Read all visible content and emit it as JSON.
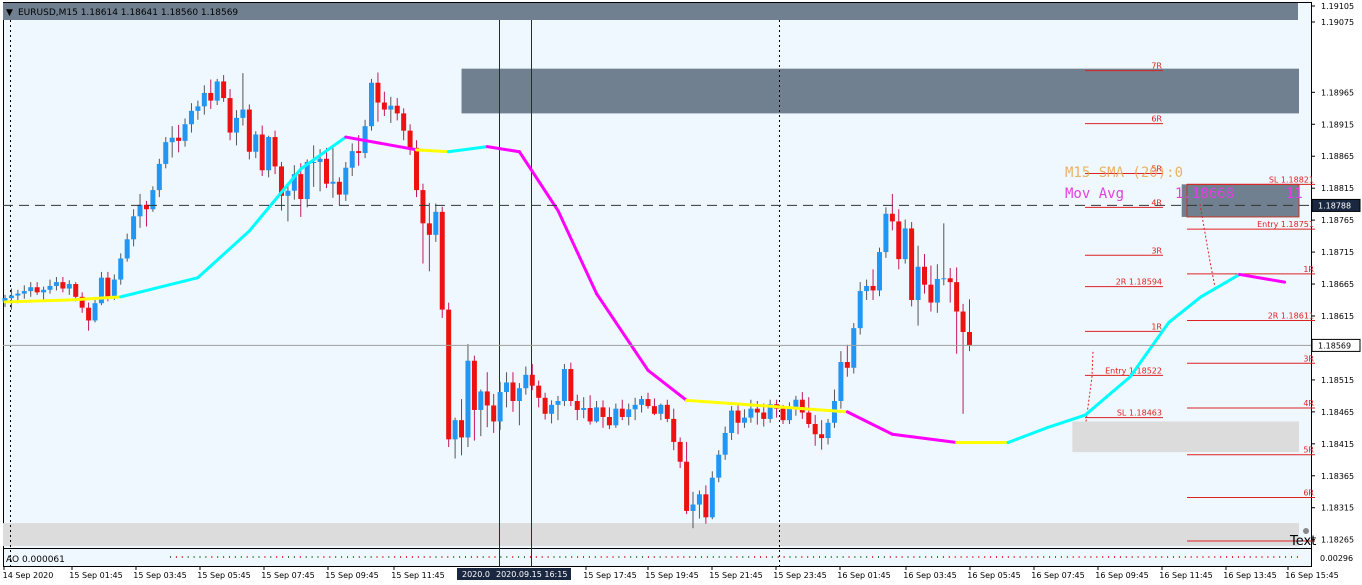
{
  "header": {
    "menu_glyph": "▼",
    "symbol_info": "EURUSD,M15  1.18614 1.18641 1.18560 1.18569"
  },
  "indicator_window": {
    "label": "AO 0.000061",
    "scale_label": "0.00296"
  },
  "chart_data": {
    "type": "candlestick",
    "symbol": "EURUSD",
    "timeframe": "M15",
    "ohlc_header": {
      "open": 1.18614,
      "high": 1.18641,
      "low": 1.1856,
      "close": 1.18569
    },
    "ylim": [
      1.18252,
      1.19075
    ],
    "y_ticks": [
      "1.19105",
      "1.19075",
      "1.18965",
      "1.18915",
      "1.18865",
      "1.18815",
      "1.18765",
      "1.18715",
      "1.18665",
      "1.18615",
      "1.18565",
      "1.18515",
      "1.18465",
      "1.18415",
      "1.18365",
      "1.18315",
      "1.18265"
    ],
    "x_ticks": [
      "14 Sep 2020",
      "15 Sep 01:45",
      "15 Sep 03:45",
      "15 Sep 05:45",
      "15 Sep 07:45",
      "15 Sep 09:45",
      "15 Sep 11:45",
      "15 Sep 17:45",
      "15 Sep 19:45",
      "15 Sep 21:45",
      "15 Sep 23:45",
      "16 Sep 01:45",
      "16 Sep 03:45",
      "16 Sep 05:45",
      "16 Sep 07:45",
      "16 Sep 09:45",
      "16 Sep 11:45",
      "16 Sep 13:45",
      "16 Sep 15:45"
    ],
    "time_markers": [
      "2020.0",
      "2020.09.15 16:15"
    ],
    "price_badges": [
      {
        "price": 1.18788,
        "label": "1.18788",
        "kind": "crosshair"
      },
      {
        "price": 1.18569,
        "label": "1.18569",
        "kind": "bid"
      }
    ],
    "crosshair_price": 1.18788,
    "bid_price": 1.18569,
    "bull_color": "#2196f3",
    "bear_color": "#ee1111",
    "ma_color_up": "#00ffff",
    "ma_color_down": "#ff00ff",
    "ma_color_flat": "#ffff00",
    "sma_label": "M15 SMA (20):0",
    "mov_avg_label": "Mov Avg",
    "mov_avg_value": "1.18668",
    "mov_avg_suffix": "11",
    "text_label": "Text",
    "zones": [
      {
        "name": "supply-zone-top",
        "t0": 71,
        "t1": 210,
        "high": 1.19002,
        "low": 1.18932,
        "color": "#708090"
      },
      {
        "name": "supply-zone-right",
        "t0": 183,
        "t1": 210,
        "high": 1.18821,
        "low": 1.1877,
        "color": "#708090"
      },
      {
        "name": "demand-zone-mid",
        "t0": 166,
        "t1": 210,
        "high": 1.1845,
        "low": 1.18402,
        "color": "#dcdcdc"
      },
      {
        "name": "demand-zone-bottom",
        "t0": 0,
        "t1": 210,
        "high": 1.18291,
        "low": 1.18255,
        "color": "#dcdcdc"
      }
    ],
    "levels_group1": [
      {
        "label": "",
        "price": 1.19089
      },
      {
        "label": "7R",
        "price": 1.18999
      },
      {
        "label": "6R",
        "price": 1.18916
      },
      {
        "label": "5R",
        "price": 1.18838
      },
      {
        "label": "4R",
        "price": 1.18785
      },
      {
        "label": "3R",
        "price": 1.1871
      },
      {
        "label": "2R 1.18594",
        "price": 1.18661
      },
      {
        "label": "1R",
        "price": 1.18591
      },
      {
        "label": "Entry 1.18522",
        "price": 1.18522
      },
      {
        "label": "SL 1.18463",
        "price": 1.18456
      }
    ],
    "levels_group2": [
      {
        "label": "SL 1.18821",
        "price": 1.18821
      },
      {
        "label": "Entry 1.18751",
        "price": 1.18751
      },
      {
        "label": "1R",
        "price": 1.18681
      },
      {
        "label": "2R 1.18611",
        "price": 1.18608
      },
      {
        "label": "3R",
        "price": 1.18541
      },
      {
        "label": "4R",
        "price": 1.18471
      },
      {
        "label": "5R",
        "price": 1.18398
      },
      {
        "label": "6R",
        "price": 1.18331
      },
      {
        "label": "",
        "price": 1.18263
      }
    ],
    "moving_average": [
      [
        0,
        1.18637
      ],
      [
        10,
        1.1864
      ],
      [
        18,
        1.18645
      ],
      [
        30,
        1.18675
      ],
      [
        38,
        1.18748
      ],
      [
        46,
        1.18845
      ],
      [
        53,
        1.18895
      ],
      [
        64,
        1.18875
      ],
      [
        69,
        1.18872
      ],
      [
        75,
        1.1888
      ],
      [
        80,
        1.18872
      ],
      [
        86,
        1.1878
      ],
      [
        92,
        1.1865
      ],
      [
        100,
        1.1853
      ],
      [
        106,
        1.18483
      ],
      [
        116,
        1.18476
      ],
      [
        124,
        1.1847
      ],
      [
        131,
        1.18465
      ],
      [
        138,
        1.1843
      ],
      [
        148,
        1.18417
      ],
      [
        156,
        1.18417
      ],
      [
        162,
        1.1844
      ],
      [
        168,
        1.1846
      ],
      [
        175,
        1.1852
      ],
      [
        181,
        1.18605
      ],
      [
        186,
        1.18645
      ],
      [
        192,
        1.1868
      ],
      [
        199,
        1.18668
      ]
    ],
    "candles": [
      [
        1.18638,
        1.18648,
        1.18629,
        1.18643
      ],
      [
        1.18643,
        1.18658,
        1.18625,
        1.18647
      ],
      [
        1.18647,
        1.18656,
        1.18635,
        1.1865
      ],
      [
        1.1865,
        1.18663,
        1.18642,
        1.18654
      ],
      [
        1.18654,
        1.18668,
        1.18645,
        1.1866
      ],
      [
        1.1866,
        1.18668,
        1.18648,
        1.18652
      ],
      [
        1.18652,
        1.18661,
        1.18638,
        1.18656
      ],
      [
        1.18656,
        1.18672,
        1.1865,
        1.18662
      ],
      [
        1.18662,
        1.18676,
        1.18655,
        1.18668
      ],
      [
        1.18668,
        1.18676,
        1.18652,
        1.18658
      ],
      [
        1.18658,
        1.18671,
        1.18648,
        1.18665
      ],
      [
        1.18665,
        1.18668,
        1.18638,
        1.18645
      ],
      [
        1.18645,
        1.18652,
        1.1862,
        1.18628
      ],
      [
        1.18628,
        1.18636,
        1.18592,
        1.18608
      ],
      [
        1.18608,
        1.1864,
        1.18605,
        1.18635
      ],
      [
        1.18635,
        1.18684,
        1.18632,
        1.18675
      ],
      [
        1.18675,
        1.18684,
        1.18638,
        1.18645
      ],
      [
        1.18645,
        1.1868,
        1.1864,
        1.18672
      ],
      [
        1.18672,
        1.18713,
        1.18664,
        1.18705
      ],
      [
        1.18705,
        1.18744,
        1.187,
        1.18735
      ],
      [
        1.18735,
        1.18782,
        1.18724,
        1.18771
      ],
      [
        1.18771,
        1.18806,
        1.18753,
        1.18789
      ],
      [
        1.18789,
        1.18795,
        1.18755,
        1.18782
      ],
      [
        1.18782,
        1.18818,
        1.18778,
        1.18812
      ],
      [
        1.18812,
        1.18861,
        1.18801,
        1.18853
      ],
      [
        1.18853,
        1.18895,
        1.18846,
        1.18887
      ],
      [
        1.18887,
        1.18912,
        1.18863,
        1.18894
      ],
      [
        1.18894,
        1.18914,
        1.18871,
        1.18889
      ],
      [
        1.18889,
        1.18924,
        1.1888,
        1.18915
      ],
      [
        1.18915,
        1.18948,
        1.18902,
        1.18936
      ],
      [
        1.18936,
        1.18952,
        1.18922,
        1.18943
      ],
      [
        1.18943,
        1.18976,
        1.1893,
        1.18964
      ],
      [
        1.18964,
        1.18985,
        1.18939,
        1.18952
      ],
      [
        1.18952,
        1.18986,
        1.18945,
        1.18982
      ],
      [
        1.18982,
        1.18992,
        1.1895,
        1.18956
      ],
      [
        1.18956,
        1.1897,
        1.1889,
        1.18902
      ],
      [
        1.18902,
        1.18937,
        1.18882,
        1.18925
      ],
      [
        1.18925,
        1.18995,
        1.18913,
        1.18938
      ],
      [
        1.18938,
        1.18946,
        1.1886,
        1.18872
      ],
      [
        1.18872,
        1.18904,
        1.18862,
        1.18899
      ],
      [
        1.18899,
        1.18913,
        1.18834,
        1.18843
      ],
      [
        1.18843,
        1.18897,
        1.18832,
        1.18895
      ],
      [
        1.18895,
        1.18905,
        1.18837,
        1.18849
      ],
      [
        1.18849,
        1.18856,
        1.1878,
        1.18803
      ],
      [
        1.18803,
        1.18821,
        1.18763,
        1.18811
      ],
      [
        1.18811,
        1.18851,
        1.18797,
        1.18837
      ],
      [
        1.18837,
        1.18854,
        1.1877,
        1.18798
      ],
      [
        1.18798,
        1.1886,
        1.18785,
        1.18856
      ],
      [
        1.18856,
        1.18882,
        1.18817,
        1.18856
      ],
      [
        1.18856,
        1.18876,
        1.1881,
        1.18861
      ],
      [
        1.18861,
        1.18878,
        1.18815,
        1.18822
      ],
      [
        1.18822,
        1.1888,
        1.188,
        1.18825
      ],
      [
        1.18825,
        1.18832,
        1.18788,
        1.18805
      ],
      [
        1.18805,
        1.18856,
        1.18795,
        1.18847
      ],
      [
        1.18847,
        1.18885,
        1.18834,
        1.18873
      ],
      [
        1.18873,
        1.18898,
        1.1885,
        1.1887
      ],
      [
        1.1887,
        1.18922,
        1.18862,
        1.18912
      ],
      [
        1.18912,
        1.18986,
        1.18905,
        1.1898
      ],
      [
        1.1898,
        1.18996,
        1.18919,
        1.18949
      ],
      [
        1.18949,
        1.18966,
        1.18928,
        1.18938
      ],
      [
        1.18938,
        1.18958,
        1.18917,
        1.18944
      ],
      [
        1.18944,
        1.18956,
        1.18921,
        1.18932
      ],
      [
        1.18932,
        1.1894,
        1.1889,
        1.18905
      ],
      [
        1.18905,
        1.18915,
        1.18867,
        1.18878
      ],
      [
        1.18878,
        1.1889,
        1.18801,
        1.18812
      ],
      [
        1.18812,
        1.18822,
        1.18697,
        1.1876
      ],
      [
        1.1876,
        1.18792,
        1.18685,
        1.18742
      ],
      [
        1.18742,
        1.18791,
        1.18731,
        1.18778
      ],
      [
        1.18778,
        1.18786,
        1.18612,
        1.18625
      ],
      [
        1.18625,
        1.18636,
        1.1841,
        1.18422
      ],
      [
        1.18422,
        1.18456,
        1.18392,
        1.18452
      ],
      [
        1.18452,
        1.18485,
        1.18397,
        1.18425
      ],
      [
        1.18425,
        1.18571,
        1.1841,
        1.18545
      ],
      [
        1.18545,
        1.18553,
        1.1842,
        1.18468
      ],
      [
        1.18468,
        1.185,
        1.18427,
        1.18497
      ],
      [
        1.18497,
        1.18527,
        1.18441,
        1.18475
      ],
      [
        1.18475,
        1.18493,
        1.18432,
        1.1845
      ],
      [
        1.1845,
        1.18512,
        1.18437,
        1.18496
      ],
      [
        1.18496,
        1.18527,
        1.18472,
        1.18511
      ],
      [
        1.18511,
        1.18527,
        1.18465,
        1.18482
      ],
      [
        1.18482,
        1.1851,
        1.18444,
        1.18502
      ],
      [
        1.18502,
        1.18536,
        1.18492,
        1.18523
      ],
      [
        1.18523,
        1.1854,
        1.18499,
        1.18506
      ],
      [
        1.18506,
        1.18514,
        1.18472,
        1.18487
      ],
      [
        1.18487,
        1.18495,
        1.18453,
        1.18462
      ],
      [
        1.18462,
        1.18483,
        1.18447,
        1.18476
      ],
      [
        1.18476,
        1.1849,
        1.18452,
        1.18482
      ],
      [
        1.18482,
        1.1854,
        1.18474,
        1.18532
      ],
      [
        1.18532,
        1.18542,
        1.18474,
        1.18482
      ],
      [
        1.18482,
        1.18492,
        1.18452,
        1.18468
      ],
      [
        1.18468,
        1.18488,
        1.18455,
        1.18471
      ],
      [
        1.18471,
        1.18491,
        1.18445,
        1.1845
      ],
      [
        1.1845,
        1.18482,
        1.18448,
        1.18472
      ],
      [
        1.18472,
        1.18483,
        1.1844,
        1.18457
      ],
      [
        1.18457,
        1.18472,
        1.18438,
        1.18444
      ],
      [
        1.18444,
        1.18478,
        1.1844,
        1.1847
      ],
      [
        1.1847,
        1.18484,
        1.18452,
        1.18457
      ],
      [
        1.18457,
        1.18478,
        1.18444,
        1.18469
      ],
      [
        1.18469,
        1.18487,
        1.18452,
        1.18476
      ],
      [
        1.18476,
        1.1849,
        1.18464,
        1.18485
      ],
      [
        1.18485,
        1.18495,
        1.1847,
        1.18474
      ],
      [
        1.18474,
        1.18486,
        1.1846,
        1.18462
      ],
      [
        1.18462,
        1.18478,
        1.18452,
        1.18476
      ],
      [
        1.18476,
        1.18484,
        1.18449,
        1.18454
      ],
      [
        1.18454,
        1.1847,
        1.18405,
        1.18418
      ],
      [
        1.18418,
        1.18425,
        1.18377,
        1.18387
      ],
      [
        1.18387,
        1.18418,
        1.18305,
        1.1831
      ],
      [
        1.1831,
        1.1834,
        1.18283,
        1.1832
      ],
      [
        1.1832,
        1.18342,
        1.18298,
        1.18336
      ],
      [
        1.18336,
        1.1835,
        1.1829,
        1.183
      ],
      [
        1.183,
        1.18372,
        1.18297,
        1.18362
      ],
      [
        1.18362,
        1.18405,
        1.18355,
        1.18398
      ],
      [
        1.18398,
        1.18442,
        1.1839,
        1.18432
      ],
      [
        1.18432,
        1.18474,
        1.18421,
        1.18467
      ],
      [
        1.18467,
        1.18475,
        1.1843,
        1.18448
      ],
      [
        1.18448,
        1.18469,
        1.1844,
        1.18456
      ],
      [
        1.18456,
        1.18484,
        1.18448,
        1.1847
      ],
      [
        1.1847,
        1.18482,
        1.18445,
        1.18464
      ],
      [
        1.18464,
        1.18478,
        1.18442,
        1.18454
      ],
      [
        1.18454,
        1.18484,
        1.18448,
        1.18477
      ],
      [
        1.18477,
        1.18484,
        1.18456,
        1.1847
      ],
      [
        1.1847,
        1.18476,
        1.18446,
        1.18452
      ],
      [
        1.18452,
        1.1848,
        1.18446,
        1.1847
      ],
      [
        1.1847,
        1.1849,
        1.18459,
        1.18484
      ],
      [
        1.18484,
        1.18496,
        1.18454,
        1.18464
      ],
      [
        1.18464,
        1.18488,
        1.1844,
        1.18446
      ],
      [
        1.18446,
        1.1846,
        1.18412,
        1.1843
      ],
      [
        1.1843,
        1.18452,
        1.18406,
        1.18424
      ],
      [
        1.18424,
        1.18454,
        1.18414,
        1.18448
      ],
      [
        1.18448,
        1.185,
        1.1844,
        1.18482
      ],
      [
        1.18482,
        1.1856,
        1.1847,
        1.18543
      ],
      [
        1.18543,
        1.1857,
        1.1852,
        1.18534
      ],
      [
        1.18534,
        1.18604,
        1.18525,
        1.18596
      ],
      [
        1.18596,
        1.18668,
        1.18586,
        1.18654
      ],
      [
        1.18654,
        1.18672,
        1.1864,
        1.18662
      ],
      [
        1.18662,
        1.18688,
        1.1864,
        1.18655
      ],
      [
        1.18655,
        1.18722,
        1.18646,
        1.18715
      ],
      [
        1.18715,
        1.18785,
        1.18706,
        1.18775
      ],
      [
        1.18775,
        1.18806,
        1.18749,
        1.18763
      ],
      [
        1.18763,
        1.18782,
        1.18688,
        1.18704
      ],
      [
        1.18704,
        1.18766,
        1.18697,
        1.18752
      ],
      [
        1.18752,
        1.18762,
        1.1863,
        1.1864
      ],
      [
        1.1864,
        1.18725,
        1.186,
        1.18692
      ],
      [
        1.18692,
        1.18712,
        1.1865,
        1.18664
      ],
      [
        1.18664,
        1.18694,
        1.18622,
        1.18636
      ],
      [
        1.18636,
        1.18696,
        1.1862,
        1.18673
      ],
      [
        1.18673,
        1.1876,
        1.18663,
        1.18674
      ],
      [
        1.18674,
        1.1869,
        1.18636,
        1.18668
      ],
      [
        1.18668,
        1.18691,
        1.18556,
        1.18622
      ],
      [
        1.18622,
        1.18634,
        1.18462,
        1.1859
      ],
      [
        1.1859,
        1.18641,
        1.1856,
        1.18569
      ]
    ]
  }
}
